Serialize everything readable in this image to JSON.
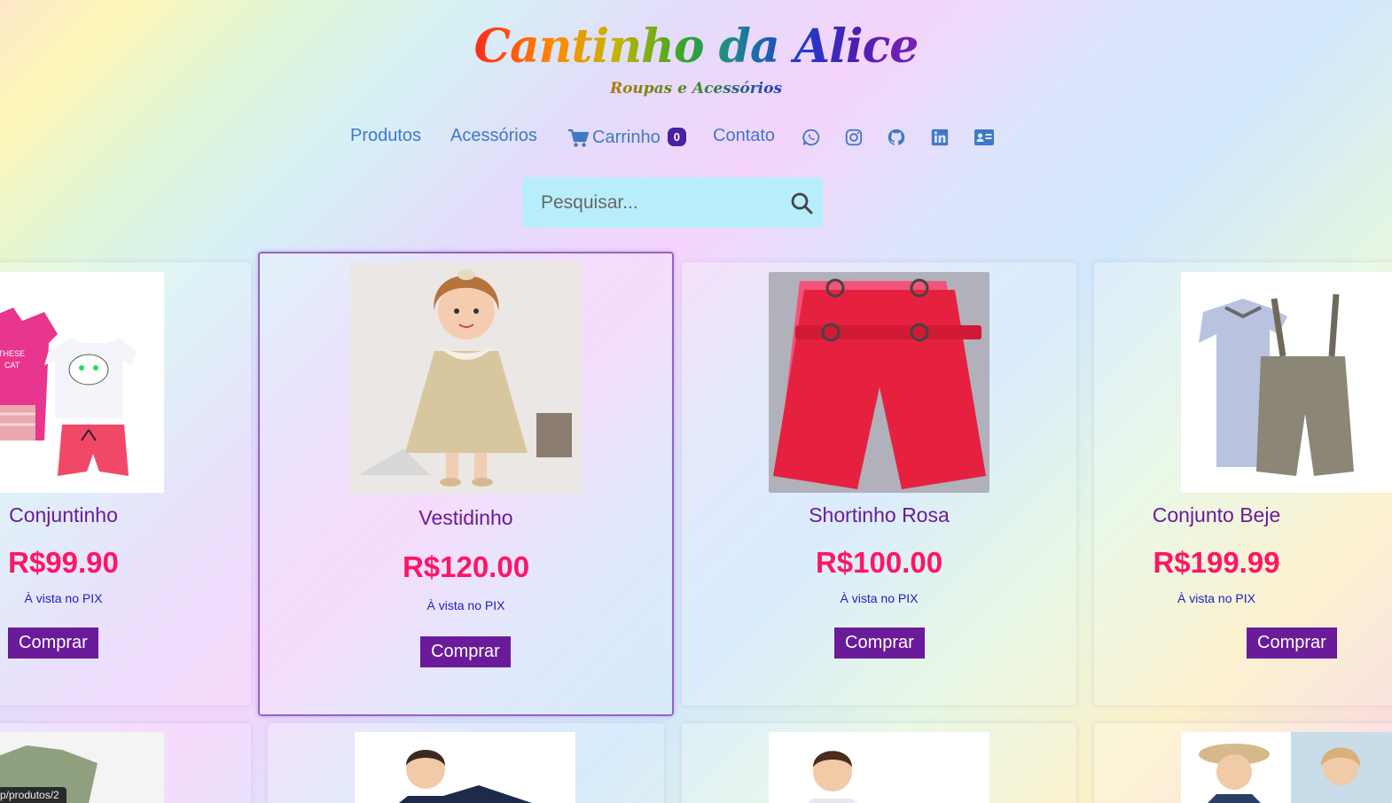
{
  "header": {
    "title": "Cantinho da Alice",
    "subtitle": "Roupas e Acessórios"
  },
  "nav": {
    "produtos": "Produtos",
    "acessorios": "Acessórios",
    "carrinho": "Carrinho",
    "cart_count": "0",
    "contato": "Contato",
    "social_icons": [
      "whatsapp-icon",
      "instagram-icon",
      "github-icon",
      "linkedin-icon",
      "contact-card-icon"
    ]
  },
  "search": {
    "placeholder": "Pesquisar..."
  },
  "products": [
    {
      "name": "Conjuntinho",
      "price": "R$99.90",
      "pix": "À vista no PIX",
      "buy": "Comprar"
    },
    {
      "name": "Vestidinho",
      "price": "R$120.00",
      "pix": "À vista no PIX",
      "buy": "Comprar"
    },
    {
      "name": "Shortinho Rosa",
      "price": "R$100.00",
      "pix": "À vista no PIX",
      "buy": "Comprar"
    },
    {
      "name": "Conjunto Beje",
      "price": "R$199.99",
      "pix": "À vista no PIX",
      "buy": "Comprar"
    }
  ],
  "statusbar": {
    "url": "p/produtos/2"
  },
  "colors": {
    "nav_link": "#3f79c6",
    "product_name": "#6a1b9a",
    "price": "#ff1566",
    "buy_button": "#6a1b9a",
    "search_bg": "#b8eefc",
    "badge": "#4a1fa0"
  }
}
